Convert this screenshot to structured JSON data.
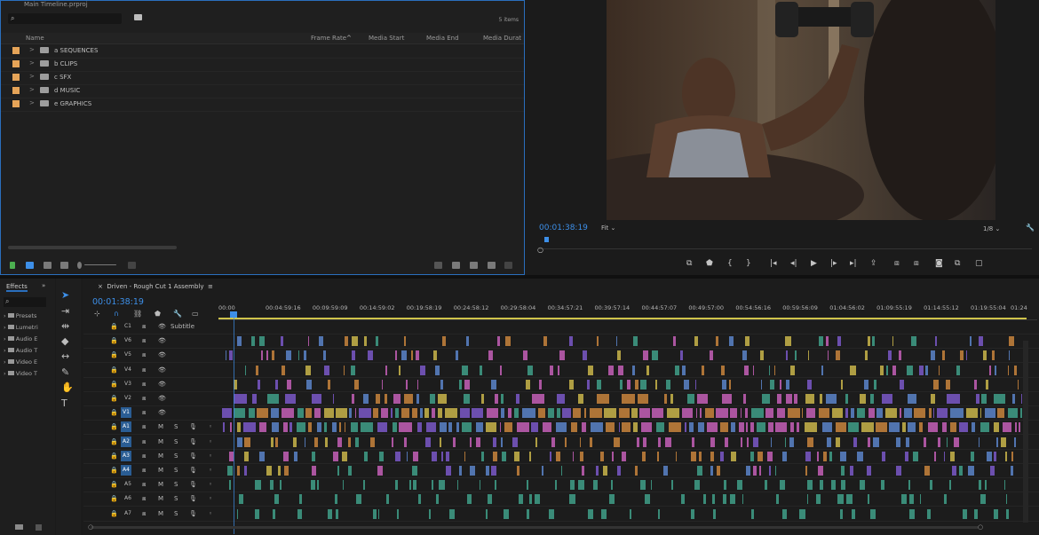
{
  "project": {
    "title": "Main Timeline.prproj",
    "search_placeholder": "",
    "item_count": "5 items",
    "columns": [
      "Name",
      "Frame Rate",
      "Media Start",
      "Media End",
      "Media Durat"
    ],
    "bins": [
      {
        "name": "a SEQUENCES"
      },
      {
        "name": "b CLIPS"
      },
      {
        "name": "c SFX"
      },
      {
        "name": "d MUSIC"
      },
      {
        "name": "e GRAPHICS"
      }
    ]
  },
  "program": {
    "timecode": "00:01:38:19",
    "fit": "Fit",
    "resolution": "1/8"
  },
  "effects": {
    "title": "Effects",
    "items": [
      "Presets",
      "Lumetri",
      "Audio E",
      "Audio T",
      "Video E",
      "Video T"
    ]
  },
  "timeline": {
    "sequence_name": "Driven - Rough Cut 1 Assembly",
    "timecode": "00:01:38:19",
    "ruler_ticks": [
      "00:00",
      "00:04:59:16",
      "00:09:59:09",
      "00:14:59:02",
      "00:19:58:19",
      "00:24:58:12",
      "00:29:58:04",
      "00:34:57:21",
      "00:39:57:14",
      "00:44:57:07",
      "00:49:57:00",
      "00:54:56:16",
      "00:59:56:09",
      "01:04:56:02",
      "01:09:55:19",
      "01:14:55:12",
      "01:19:55:04",
      "01:24"
    ],
    "tracks": [
      {
        "id": "C1",
        "kind": "caption",
        "label": "Subtitle"
      },
      {
        "id": "V6",
        "kind": "video"
      },
      {
        "id": "V5",
        "kind": "video"
      },
      {
        "id": "V4",
        "kind": "video"
      },
      {
        "id": "V3",
        "kind": "video"
      },
      {
        "id": "V2",
        "kind": "video"
      },
      {
        "id": "V1",
        "kind": "video",
        "target": "V1"
      },
      {
        "id": "A1",
        "kind": "audio",
        "target": "A1"
      },
      {
        "id": "A2",
        "kind": "audio",
        "target": "A2"
      },
      {
        "id": "A3",
        "kind": "audio",
        "target": "A3"
      },
      {
        "id": "A4",
        "kind": "audio",
        "target": "A4"
      },
      {
        "id": "A5",
        "kind": "audio"
      },
      {
        "id": "A6",
        "kind": "audio"
      },
      {
        "id": "A7",
        "kind": "audio"
      }
    ],
    "track_button_labels": {
      "mute": "M",
      "solo": "S"
    }
  },
  "colors": {
    "accent": "#3d8fe8",
    "bin": "#e6a458",
    "clip_blue": "#5a84c9",
    "clip_orange": "#c8843c",
    "clip_pink": "#c45fb7",
    "clip_teal": "#3f9f88",
    "clip_violet": "#7a58c8",
    "clip_yellow": "#c9b54a"
  }
}
